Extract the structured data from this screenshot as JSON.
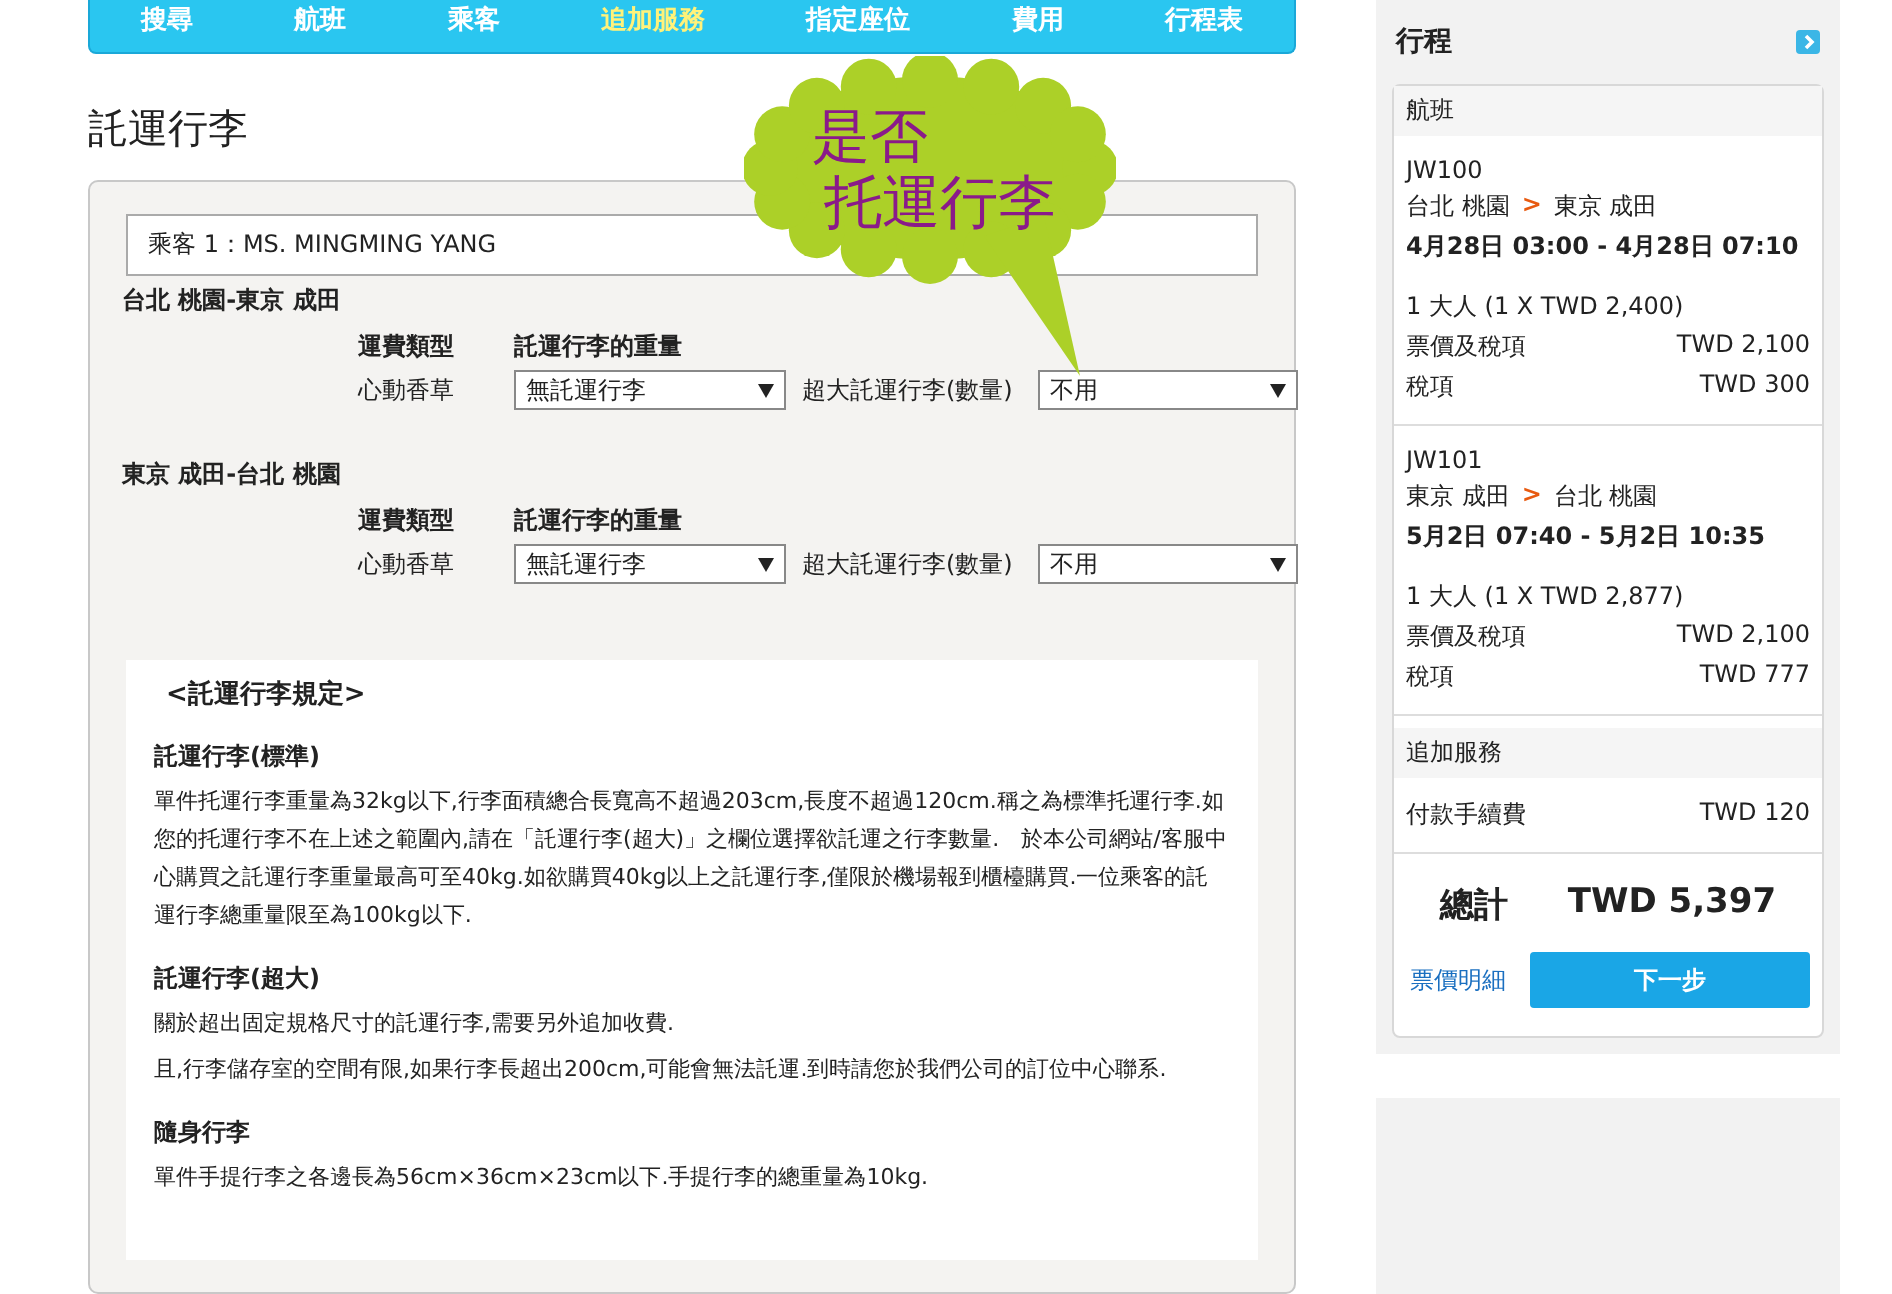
{
  "nav": [
    {
      "label": "搜尋",
      "selected": false
    },
    {
      "label": "航班",
      "selected": false
    },
    {
      "label": "乘客",
      "selected": false
    },
    {
      "label": "追加服務",
      "selected": true
    },
    {
      "label": "指定座位",
      "selected": false
    },
    {
      "label": "費用",
      "selected": false
    },
    {
      "label": "行程表",
      "selected": false
    }
  ],
  "callout": {
    "lines": [
      "是否",
      "托運行李"
    ]
  },
  "page_title": "託運行李",
  "passenger": "乘客 1：MS. MINGMING YANG",
  "segments": [
    {
      "route": "台北 桃園-東京 成田",
      "fare_type_label": "運費類型",
      "fare_type": "心動香草",
      "weight_label": "託運行李的重量",
      "weight_value": "無託運行李",
      "oversize_label": "超大託運行李(數量)",
      "oversize_value": "不用"
    },
    {
      "route": "東京 成田-台北 桃園",
      "fare_type_label": "運費類型",
      "fare_type": "心動香草",
      "weight_label": "託運行李的重量",
      "weight_value": "無託運行李",
      "oversize_label": "超大託運行李(數量)",
      "oversize_value": "不用"
    }
  ],
  "rules": {
    "title": "<託運行李規定>",
    "sections": [
      {
        "heading": "託運行李(標準)",
        "paragraphs": [
          "單件托運行李重量為32kg以下,行李面積總合長寬高不超過203cm,長度不超過120cm.稱之為標準托運行李.如您的托運行李不在上述之範圍內,請在「託運行李(超大)」之欄位選擇欲託運之行李數量.　於本公司網站/客服中心購買之託運行李重量最高可至40kg.如欲購買40kg以上之託運行李,僅限於機場報到櫃檯購買.一位乘客的託運行李總重量限至為100kg以下."
        ]
      },
      {
        "heading": "託運行李(超大)",
        "paragraphs": [
          "關於超出固定規格尺寸的託運行李,需要另外追加收費.",
          "且,行李儲存室的空間有限,如果行李長超出200cm,可能會無法託運.到時請您於我們公司的訂位中心聯系."
        ]
      },
      {
        "heading": "隨身行李",
        "paragraphs": [
          "單件手提行李之各邊長為56cm×36cm×23cm以下.手提行李的總重量為10kg."
        ]
      }
    ]
  },
  "itinerary": {
    "title": "行程",
    "flights_heading": "航班",
    "flights": [
      {
        "number": "JW100",
        "from": "台北 桃園",
        "arrow": ">",
        "to": "東京 成田",
        "time": "4月28日 03:00 - 4月28日 07:10",
        "pax": "1 大人 (1 X TWD 2,400)",
        "lines": [
          {
            "label": "票價及稅項",
            "amount": "TWD 2,100"
          },
          {
            "label": "稅項",
            "amount": "TWD 300"
          }
        ]
      },
      {
        "number": "JW101",
        "from": "東京 成田",
        "arrow": ">",
        "to": "台北 桃園",
        "time": "5月2日 07:40 - 5月2日 10:35",
        "pax": "1 大人 (1 X TWD 2,877)",
        "lines": [
          {
            "label": "票價及稅項",
            "amount": "TWD 2,100"
          },
          {
            "label": "稅項",
            "amount": "TWD 777"
          }
        ]
      }
    ],
    "extras_heading": "追加服務",
    "extras": [
      {
        "label": "付款手續費",
        "amount": "TWD 120"
      }
    ],
    "total_label": "總計",
    "total": "TWD 5,397",
    "details_link": "票價明細",
    "next_button": "下一步"
  }
}
